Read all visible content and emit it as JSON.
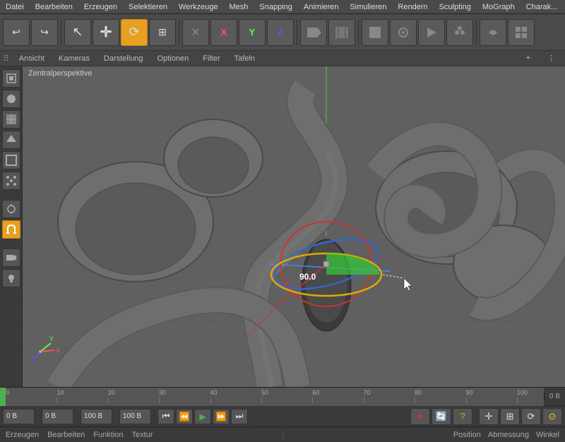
{
  "menubar": {
    "items": [
      "Datei",
      "Bearbeiten",
      "Erzeugen",
      "Selektieren",
      "Werkzeuge",
      "Mesh",
      "Snapping",
      "Animieren",
      "Simulieren",
      "Rendern",
      "Sculpting",
      "MoGraph",
      "Charak..."
    ]
  },
  "toolbar": {
    "buttons": [
      {
        "id": "undo",
        "icon": "↩",
        "label": "Undo",
        "active": false
      },
      {
        "id": "redo",
        "icon": "↪",
        "label": "Redo",
        "active": false
      },
      {
        "id": "cursor",
        "icon": "↖",
        "label": "Cursor",
        "active": false
      },
      {
        "id": "move",
        "icon": "+",
        "label": "Move",
        "active": false
      },
      {
        "id": "rotate",
        "icon": "⟳",
        "label": "Rotate",
        "active": true
      },
      {
        "id": "scale",
        "icon": "⊞",
        "label": "Scale",
        "active": false
      },
      {
        "id": "cancel-x",
        "icon": "✕",
        "label": "Cancel X",
        "active": false
      },
      {
        "id": "y-axis",
        "icon": "Y",
        "label": "Y Axis",
        "active": false
      },
      {
        "id": "z-axis",
        "icon": "Z",
        "label": "Z Axis",
        "active": false
      },
      {
        "id": "film",
        "icon": "🎬",
        "label": "Film",
        "active": false
      },
      {
        "id": "keyframe",
        "icon": "◆",
        "label": "Keyframe",
        "active": false
      },
      {
        "id": "cube-solid",
        "icon": "■",
        "label": "Cube Solid",
        "active": false
      },
      {
        "id": "refresh",
        "icon": "⟳",
        "label": "Refresh",
        "active": false
      },
      {
        "id": "gem",
        "icon": "◈",
        "label": "Gem",
        "active": false
      },
      {
        "id": "arrow-right",
        "icon": "▶",
        "label": "Arrow",
        "active": false
      },
      {
        "id": "more1",
        "icon": "⊛",
        "label": "More",
        "active": false
      }
    ]
  },
  "viewtabs": {
    "tabs": [
      "Ansicht",
      "Kameras",
      "Darstellung",
      "Optionen",
      "Filter",
      "Tafeln"
    ]
  },
  "viewport": {
    "label": "Zentralperspektive"
  },
  "gizmo": {
    "angle": "90.0"
  },
  "timeline": {
    "ticks": [
      {
        "label": "0",
        "pos": 0
      },
      {
        "label": "10",
        "pos": 9.5
      },
      {
        "label": "20",
        "pos": 19
      },
      {
        "label": "30",
        "pos": 28.5
      },
      {
        "label": "40",
        "pos": 38
      },
      {
        "label": "50",
        "pos": 47.5
      },
      {
        "label": "60",
        "pos": 57
      },
      {
        "label": "70",
        "pos": 66.5
      },
      {
        "label": "80",
        "pos": 76
      },
      {
        "label": "90",
        "pos": 85.5
      },
      {
        "label": "100",
        "pos": 95
      }
    ]
  },
  "transport": {
    "current_frame": "0",
    "start_frame": "0 B",
    "frame_range": "100 B",
    "end_frame": "100 B",
    "buttons": [
      "⏮",
      "⏪",
      "▶",
      "⏩",
      "⏭"
    ]
  },
  "bottombar": {
    "left_items": [
      "Erzeugen",
      "Bearbeiten",
      "Funktion",
      "Textur"
    ],
    "right_items": [
      "Position",
      "Abmessung",
      "Winkel"
    ]
  },
  "colors": {
    "accent_orange": "#e8a020",
    "gizmo_red": "#cc3333",
    "gizmo_green": "#33aa33",
    "gizmo_blue": "#3366cc",
    "gizmo_yellow": "#ddaa00",
    "timeline_green": "#4CAF50",
    "bg_dark": "#3a3a3a",
    "bg_medium": "#4a4a4a",
    "bg_viewport": "#5a5a5a"
  }
}
